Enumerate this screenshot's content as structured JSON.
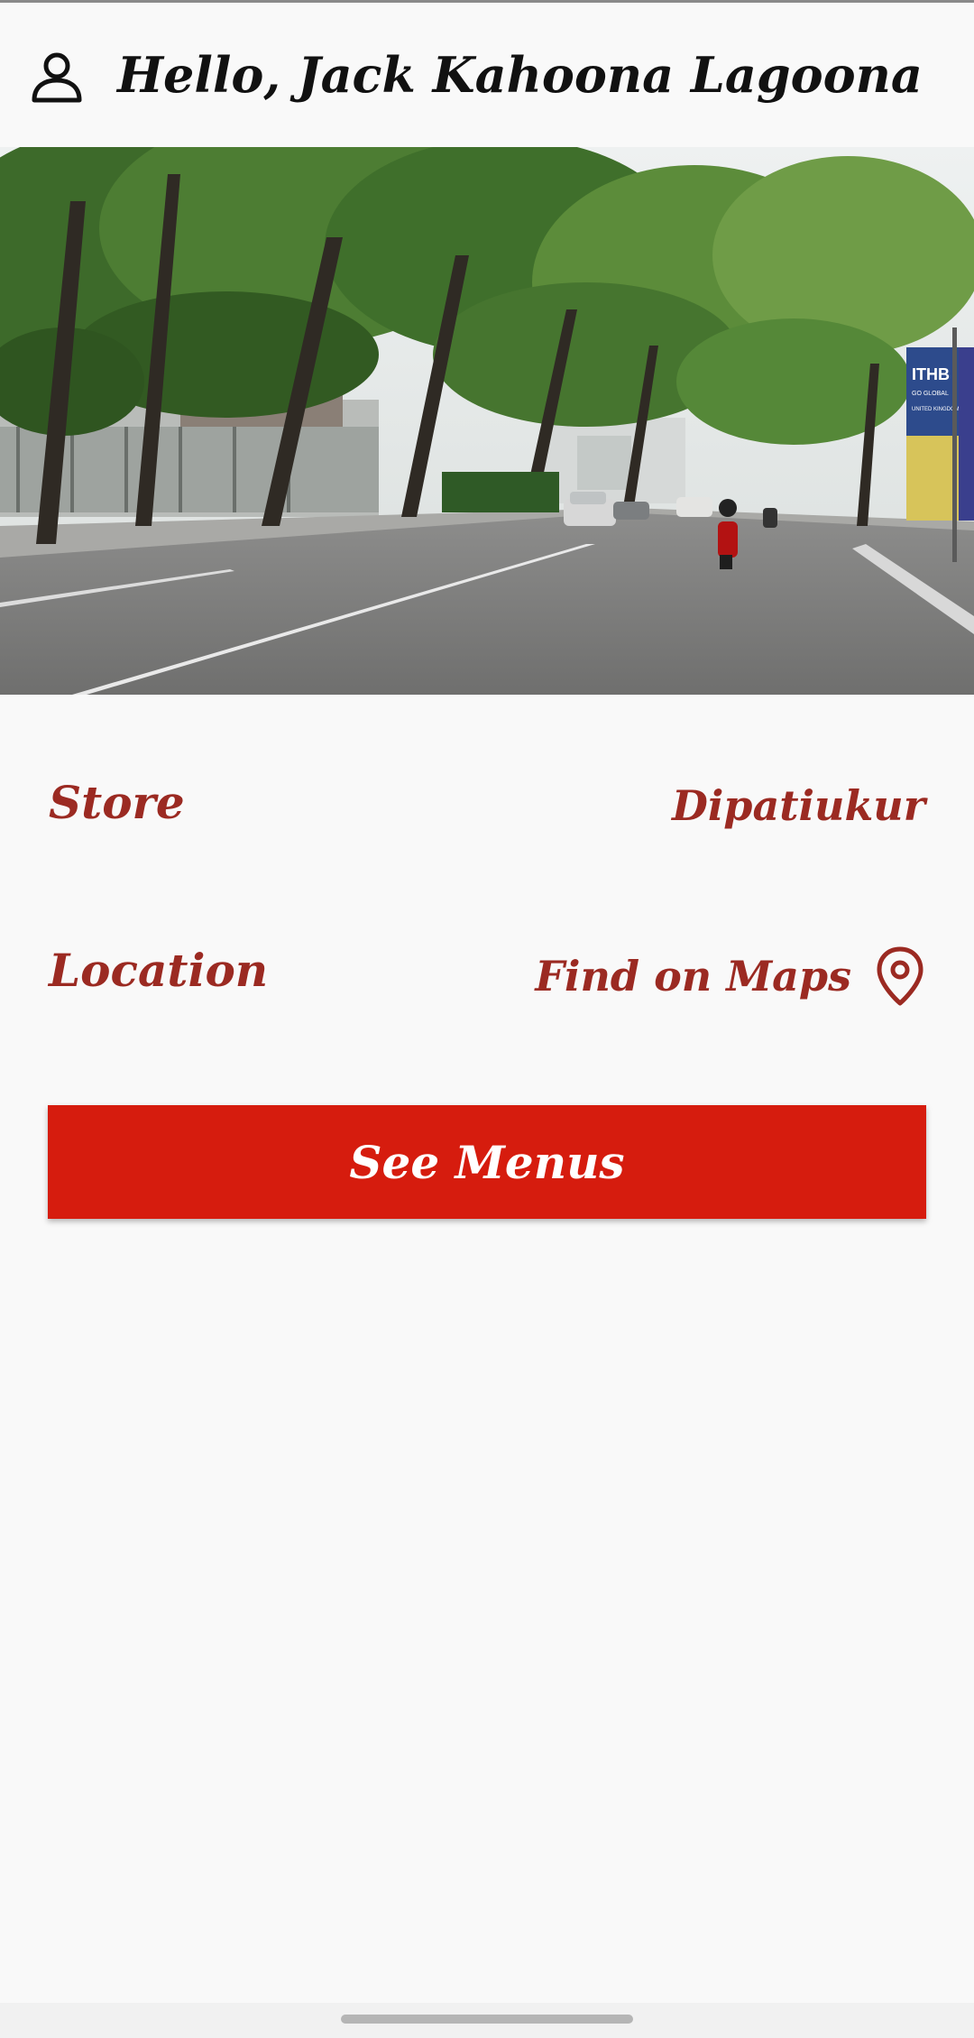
{
  "header": {
    "greeting": "Hello, Jack Kahoona Lagoona",
    "icon": "user-icon"
  },
  "hero": {
    "subject": "store-street-photo",
    "banner_text": "ITHB",
    "banner_subtext": "GO GLOBAL",
    "banner_subtext2": "UNITED KINGDOM"
  },
  "store": {
    "label": "Store",
    "value": "Dipatiukur"
  },
  "location": {
    "label": "Location",
    "link_label": "Find on Maps",
    "icon": "map-pin-icon"
  },
  "actions": {
    "see_menus_label": "See Menus"
  },
  "colors": {
    "accent_text": "#9b2a22",
    "primary_button": "#d61c0e",
    "background": "#f9f9f9"
  }
}
